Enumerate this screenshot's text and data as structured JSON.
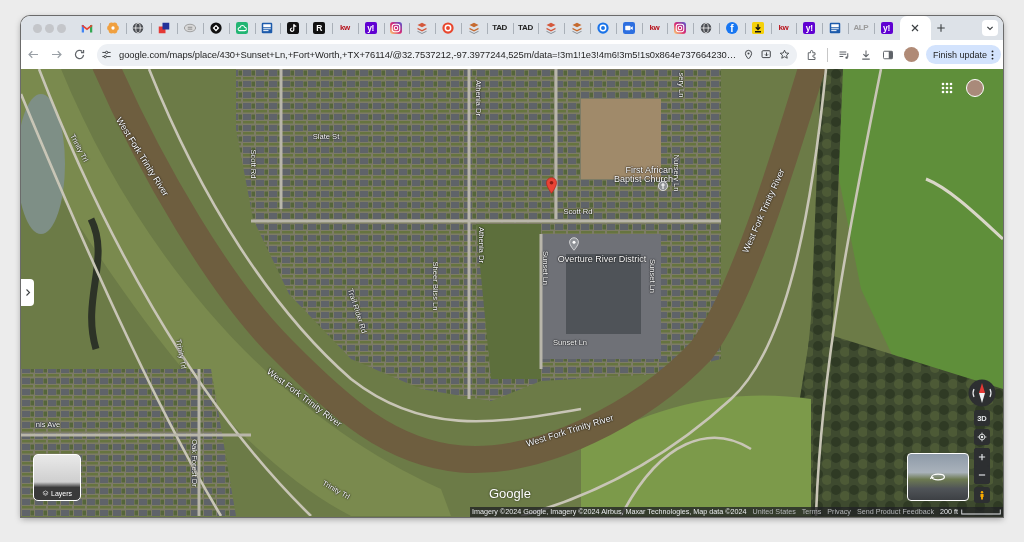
{
  "browser": {
    "tabs": [
      {
        "kind": "mail",
        "selected": false
      },
      {
        "kind": "flower",
        "color": "#f0a040",
        "selected": false
      },
      {
        "kind": "globe",
        "selected": false
      },
      {
        "kind": "squares",
        "selected": false
      },
      {
        "kind": "pill",
        "selected": false
      },
      {
        "kind": "badge",
        "selected": false
      },
      {
        "kind": "cloud",
        "color": "#22b573",
        "selected": false
      },
      {
        "kind": "document",
        "color": "#1d5bab",
        "selected": false
      },
      {
        "kind": "note",
        "selected": false
      },
      {
        "kind": "lettertile",
        "text": "R",
        "color": "#111111",
        "selected": false
      },
      {
        "kind": "letters",
        "text": "kw",
        "color": "#b8121b",
        "selected": false
      },
      {
        "kind": "lettertile",
        "text": "y!",
        "color": "#6001d2",
        "selected": false
      },
      {
        "kind": "camera",
        "selected": false
      },
      {
        "kind": "stack",
        "color": "#d4583c",
        "selected": false
      },
      {
        "kind": "ring",
        "color": "#e8472e",
        "selected": false
      },
      {
        "kind": "stack",
        "color": "#c66a2f",
        "selected": false
      },
      {
        "kind": "letters",
        "text": "TAD",
        "color": "#222222",
        "selected": false
      },
      {
        "kind": "letters",
        "text": "TAD",
        "color": "#222222",
        "selected": false
      },
      {
        "kind": "stack",
        "color": "#d4583c",
        "selected": false
      },
      {
        "kind": "stack",
        "color": "#c66a2f",
        "selected": false
      },
      {
        "kind": "ring",
        "color": "#1a73e8",
        "selected": false
      },
      {
        "kind": "video",
        "color": "#2d6fe0",
        "selected": false
      },
      {
        "kind": "letters",
        "text": "kw",
        "color": "#b8121b",
        "selected": false
      },
      {
        "kind": "camera",
        "selected": false
      },
      {
        "kind": "globe",
        "selected": false
      },
      {
        "kind": "letterdisc",
        "text": "f",
        "color": "#1877f2",
        "selected": false
      },
      {
        "kind": "download",
        "color": "#f5d10a",
        "selected": false
      },
      {
        "kind": "letters",
        "text": "kw",
        "color": "#b8121b",
        "selected": false
      },
      {
        "kind": "lettertile",
        "text": "y!",
        "color": "#6001d2",
        "selected": false
      },
      {
        "kind": "document",
        "color": "#1d5bab",
        "selected": false
      },
      {
        "kind": "letters",
        "text": "ALP",
        "color": "#9a9a9a",
        "selected": false
      },
      {
        "kind": "lettertile",
        "text": "y!",
        "color": "#6001d2",
        "selected": false
      },
      {
        "selected": true
      }
    ]
  },
  "toolbar": {
    "url": "google.com/maps/place/430+Sunset+Ln,+Fort+Worth,+TX+76114/@32.7537212,-97.3977244,525m/data=!3m1!1e3!4m6!3m5!1s0x864e737664230…",
    "update_button": "Finish update"
  },
  "map": {
    "labels": [
      {
        "kind": "river",
        "text": "West Fork Trinity River"
      },
      {
        "kind": "trail",
        "text": "Trinity Trl"
      },
      {
        "kind": "street",
        "text": "Slate St"
      },
      {
        "kind": "street",
        "text": "Athenia Dr"
      },
      {
        "kind": "street",
        "text": "sery Ln"
      },
      {
        "kind": "street",
        "text": "Nursery Ln"
      },
      {
        "kind": "street",
        "text": "Scott Rd"
      },
      {
        "kind": "place",
        "text": "First African Baptist Church"
      },
      {
        "kind": "street",
        "text": "Scott Rd"
      },
      {
        "kind": "street",
        "text": "Athenia Dr"
      },
      {
        "kind": "place",
        "text": "Overture River District"
      },
      {
        "kind": "river",
        "text": "West Fork Trinity River"
      },
      {
        "kind": "street",
        "text": "Sunset Ln"
      },
      {
        "kind": "street",
        "text": "Sunset Ln"
      },
      {
        "kind": "street",
        "text": "Sheer Bliss Ln"
      },
      {
        "kind": "street",
        "text": "Trail Rider Rd"
      },
      {
        "kind": "street",
        "text": "Sunset Ln"
      },
      {
        "kind": "trail",
        "text": "Trinity Trl"
      },
      {
        "kind": "river",
        "text": "West Fork Trinity River"
      },
      {
        "kind": "river",
        "text": "West Fork Trinity River"
      },
      {
        "kind": "street",
        "text": "nis Ave"
      },
      {
        "kind": "street",
        "text": "Oak Forest Dr"
      },
      {
        "kind": "trail",
        "text": "Trinity Trl"
      }
    ],
    "logo": "Google",
    "layers_button": "Layers",
    "tilt_button": "3D",
    "footer": {
      "attribution": "Imagery ©2024 Google, Imagery ©2024 Airbus, Maxar Technologies, Map data ©2024",
      "links": [
        "United States",
        "Terms",
        "Privacy",
        "Send Product Feedback"
      ],
      "scale": "200 ft"
    }
  }
}
